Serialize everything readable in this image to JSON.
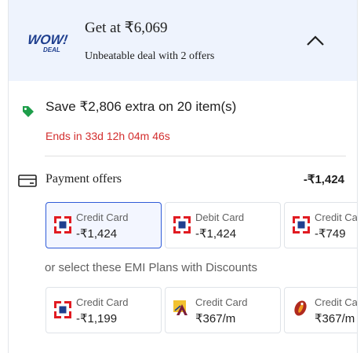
{
  "header": {
    "logo_text": "WOW! DEAL",
    "title": "Get at  ₹6,069",
    "subtitle": "Unbeatable deal with 2 offers"
  },
  "savings": {
    "text": "Save ₹2,806 extra on 20 item(s)",
    "ends": "Ends in  33d 12h 04m 46s"
  },
  "payment_offers": {
    "title": "Payment offers",
    "amount": "-₹1,424",
    "cards": [
      {
        "type": "Credit Card",
        "amount": "-₹1,424",
        "bank": "hdfc-icon"
      },
      {
        "type": "Debit Card",
        "amount": "-₹1,424",
        "bank": "hdfc-icon"
      },
      {
        "type": "Credit Card",
        "amount": "-₹749",
        "bank": "hdfc-icon"
      }
    ]
  },
  "emi": {
    "heading": "or select these EMI Plans with Discounts",
    "cards": [
      {
        "type": "Credit Card",
        "amount": "-₹1,199",
        "bank": "hdfc-icon"
      },
      {
        "type": "Credit Card",
        "amount": "₹367/m",
        "bank": "axis-bank-icon"
      },
      {
        "type": "Credit Card",
        "amount": "₹367/m",
        "bank": "icici-bank-icon"
      }
    ]
  },
  "colors": {
    "header_bg": "#eef3fd",
    "accent_blue": "#2f5bd8",
    "timer_red": "#d32f2f",
    "tag_green": "#1e9e4a",
    "hdfc_red": "#e11b22",
    "hdfc_blue": "#1f3f8f"
  }
}
